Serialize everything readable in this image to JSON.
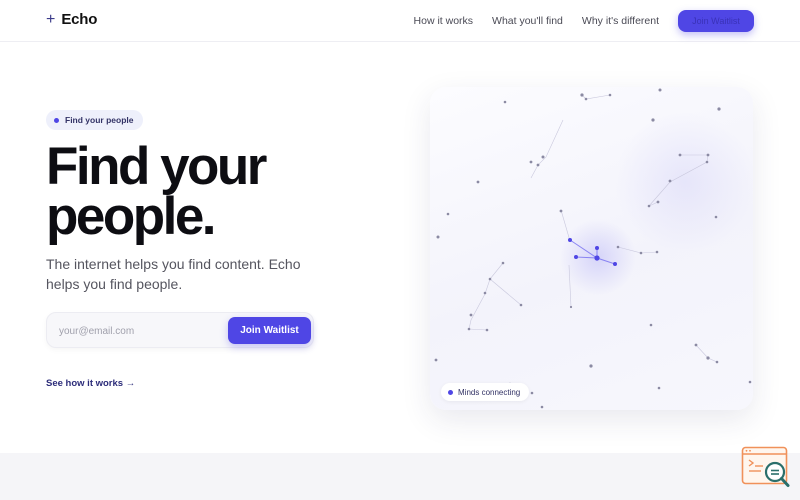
{
  "nav": {
    "logo_icon": "+",
    "logo_text": "Echo",
    "links": [
      "How it works",
      "What you'll find",
      "Why it's different"
    ],
    "cta_label": "Join Waitlist"
  },
  "hero": {
    "badge": "Find your people",
    "headline_line1": "Find your",
    "headline_line2": "people.",
    "subtitle": "The internet helps you find content. Echo helps you find people.",
    "email_placeholder": "your@email.com",
    "join_label": "Join Waitlist",
    "see_how": "See how it works →"
  },
  "card": {
    "badge": "Minds connecting"
  },
  "colors": {
    "accent": "#4f46e5",
    "text_dark": "#0d0d12",
    "text_muted": "#55555f"
  },
  "icons": {
    "logo": "plus-icon",
    "widget": "search-code-icon"
  }
}
